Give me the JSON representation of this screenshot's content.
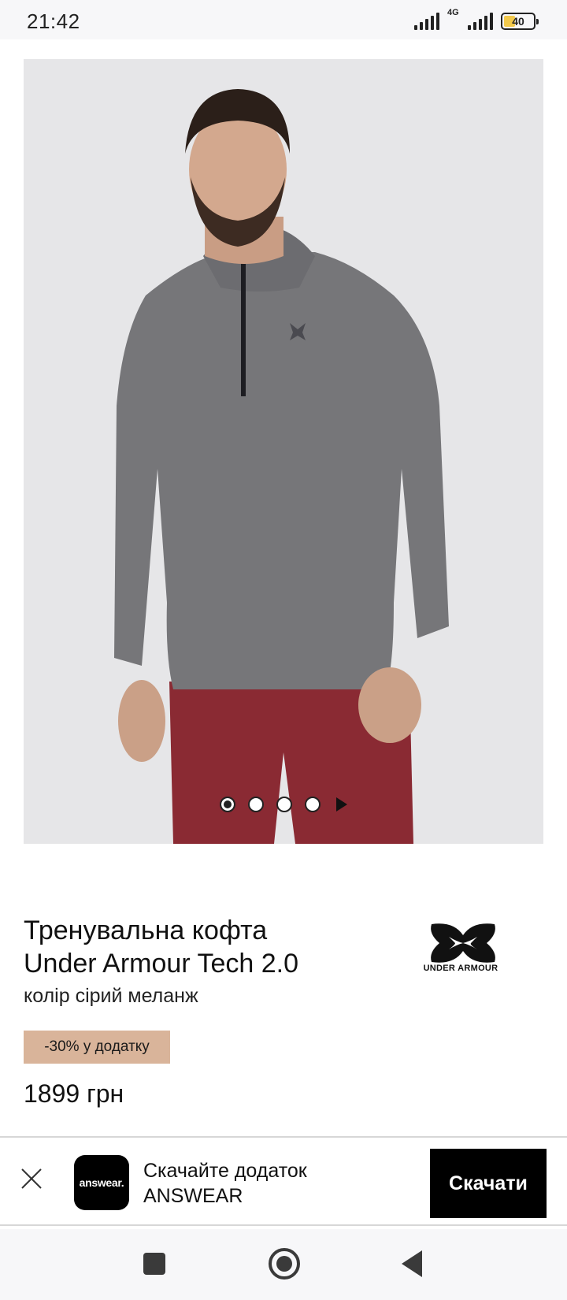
{
  "status_bar": {
    "time": "21:42",
    "network_label": "4G",
    "battery_level": "40",
    "battery_level_fraction": 0.4,
    "icons": [
      "signal-icon",
      "mobile-data-icon",
      "battery-icon"
    ]
  },
  "product": {
    "image_icon": "product-photo",
    "carousel": {
      "total_dots": 4,
      "active_index": 0,
      "next_icon": "play-arrow-icon"
    },
    "title_line1": "Тренувальна кофта",
    "title_line2": "Under Armour Tech 2.0",
    "color": "колір сірий меланж",
    "brand": "UNDER ARMOUR",
    "discount_badge": "-30% у додатку",
    "price": "1899 грн"
  },
  "app_banner": {
    "close_icon": "close-icon",
    "app_icon_text": "answear.",
    "text_line1": "Скачайте додаток",
    "text_line2": "ANSWEAR",
    "button_label": "Скачати"
  },
  "nav_bar": {
    "icons": [
      "recent-apps-icon",
      "home-icon",
      "back-icon"
    ]
  },
  "colors": {
    "badge": "#d9b49a",
    "button": "#000000",
    "image_bg": "#e6e6e8"
  }
}
